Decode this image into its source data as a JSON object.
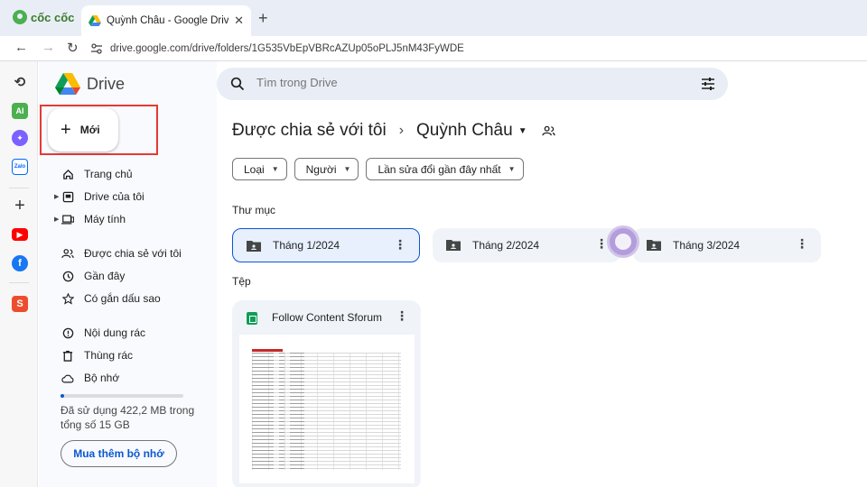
{
  "browser": {
    "brand": "cốc cốc",
    "tab_title": "Quỳnh Châu - Google Drive",
    "url": "drive.google.com/drive/folders/1G535VbEpVBRcAZUp05oPLJ5nM43FyWDE"
  },
  "browser_sidebar": {
    "icons": [
      "history-icon",
      "ai-icon",
      "messenger-icon",
      "zalo-icon",
      "add-icon",
      "youtube-icon",
      "facebook-icon",
      "shopee-icon"
    ],
    "ai_label": "AI",
    "zalo_label": "Zalo"
  },
  "drive": {
    "app_name": "Drive",
    "new_label": "Mới",
    "nav": [
      {
        "label": "Trang chủ",
        "icon": "home-icon"
      },
      {
        "label": "Drive của tôi",
        "icon": "my-drive-icon"
      },
      {
        "label": "Máy tính",
        "icon": "computer-icon"
      },
      {
        "label": "Được chia sẻ với tôi",
        "icon": "shared-icon"
      },
      {
        "label": "Gần đây",
        "icon": "recent-icon"
      },
      {
        "label": "Có gắn dấu sao",
        "icon": "star-icon"
      },
      {
        "label": "Nội dung rác",
        "icon": "spam-icon"
      },
      {
        "label": "Thùng rác",
        "icon": "trash-icon"
      },
      {
        "label": "Bộ nhớ",
        "icon": "cloud-icon"
      }
    ],
    "storage_fraction": 0.03,
    "storage_text": "Đã sử dụng 422,2 MB trong tổng số 15 GB",
    "buy_storage_label": "Mua thêm bộ nhớ"
  },
  "search": {
    "placeholder": "Tìm trong Drive"
  },
  "main": {
    "breadcrumb_root": "Được chia sẻ với tôi",
    "breadcrumb_current": "Quỳnh Châu",
    "filters": [
      "Loại",
      "Người",
      "Lần sửa đổi gần đây nhất"
    ],
    "folders_heading": "Thư mục",
    "folders": [
      {
        "name": "Tháng 1/2024",
        "selected": true
      },
      {
        "name": "Tháng 2/2024",
        "selected": false
      },
      {
        "name": "Tháng 3/2024",
        "selected": false
      }
    ],
    "files_heading": "Tệp",
    "files": [
      {
        "name": "Follow Content Sforum",
        "type": "spreadsheet"
      }
    ]
  }
}
